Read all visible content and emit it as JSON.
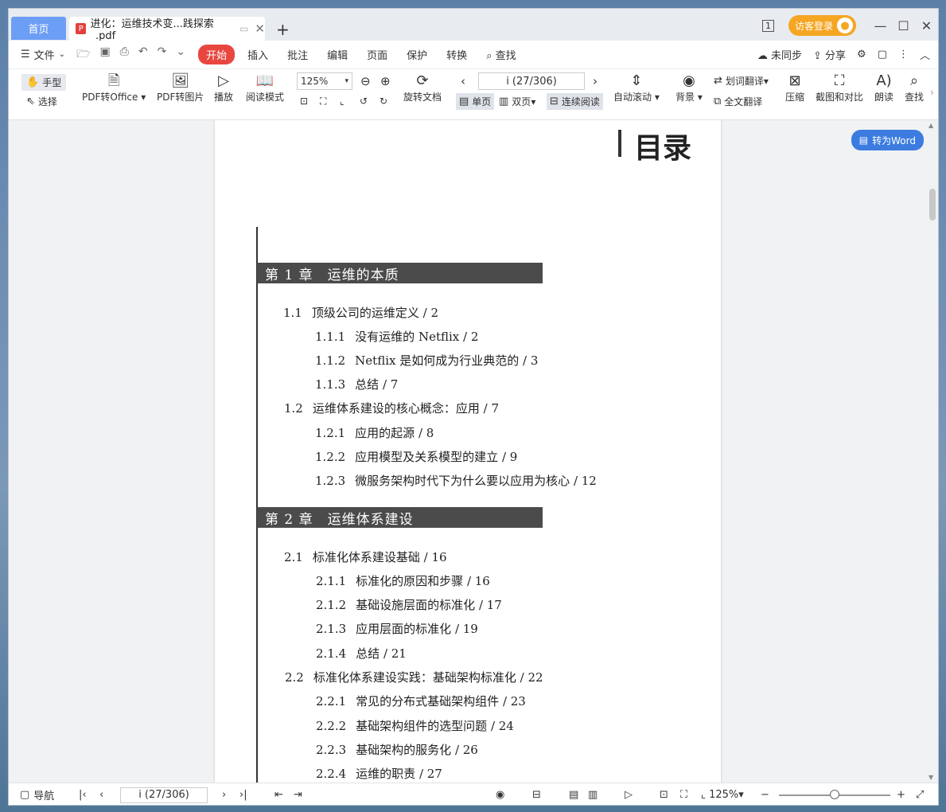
{
  "titlebar": {
    "home_tab": "首页",
    "doc_tab": "进化：运维技术变...践探索_.pdf",
    "new_tab": "+",
    "page_count_icon": "1",
    "login": "访客登录"
  },
  "menubar": {
    "file": "文件",
    "menus": [
      "开始",
      "插入",
      "批注",
      "编辑",
      "页面",
      "保护",
      "转换"
    ],
    "search": "查找",
    "sync": "未同步",
    "share": "分享"
  },
  "ribbon": {
    "hand": "手型",
    "select": "选择",
    "pdf_to_office": "PDF转Office",
    "pdf_to_image": "PDF转图片",
    "play": "播放",
    "read_mode": "阅读模式",
    "zoom": "125%",
    "rotate": "旋转文档",
    "page_indicator": "i (27/306)",
    "single_page": "单页",
    "double_page": "双页",
    "continuous": "连续阅读",
    "auto_scroll": "自动滚动",
    "background": "背景",
    "word_translate": "划词翻译",
    "full_translate": "全文翻译",
    "compress": "压缩",
    "screenshot_compare": "截图和对比",
    "read_aloud": "朗读",
    "find": "查找"
  },
  "to_word": "转为Word",
  "document": {
    "title": "目录",
    "chapters": [
      {
        "label": "第 1 章　运维的本质"
      },
      {
        "label": "第 2 章　运维体系建设"
      }
    ],
    "lines": [
      {
        "num": "1.1",
        "text": "顶级公司的运维定义 / 2"
      },
      {
        "num": "1.1.1",
        "text": "没有运维的 Netflix / 2"
      },
      {
        "num": "1.1.2",
        "text": "Netflix 是如何成为行业典范的 / 3"
      },
      {
        "num": "1.1.3",
        "text": "总结 / 7"
      },
      {
        "num": "1.2",
        "text": "运维体系建设的核心概念：应用 / 7"
      },
      {
        "num": "1.2.1",
        "text": "应用的起源 / 8"
      },
      {
        "num": "1.2.2",
        "text": "应用模型及关系模型的建立 / 9"
      },
      {
        "num": "1.2.3",
        "text": "微服务架构时代下为什么要以应用为核心 / 12"
      },
      {
        "num": "2.1",
        "text": "标准化体系建设基础 / 16"
      },
      {
        "num": "2.1.1",
        "text": "标准化的原因和步骤 / 16"
      },
      {
        "num": "2.1.2",
        "text": "基础设施层面的标准化 / 17"
      },
      {
        "num": "2.1.3",
        "text": "应用层面的标准化 / 19"
      },
      {
        "num": "2.1.4",
        "text": "总结 / 21"
      },
      {
        "num": "2.2",
        "text": "标准化体系建设实践：基础架构标准化 / 22"
      },
      {
        "num": "2.2.1",
        "text": "常见的分布式基础架构组件 / 23"
      },
      {
        "num": "2.2.2",
        "text": "基础架构组件的选型问题 / 24"
      },
      {
        "num": "2.2.3",
        "text": "基础架构的服务化 / 26"
      },
      {
        "num": "2.2.4",
        "text": "运维的职责 / 27"
      }
    ]
  },
  "statusbar": {
    "nav": "导航",
    "page": "i (27/306)",
    "zoom": "125%"
  },
  "colors": {
    "home_tab": "#6d9ef5",
    "active_menu": "#e8473f",
    "login": "#f5a623",
    "to_word": "#3c7ce0",
    "chapter_bar": "#4b4b4b"
  }
}
